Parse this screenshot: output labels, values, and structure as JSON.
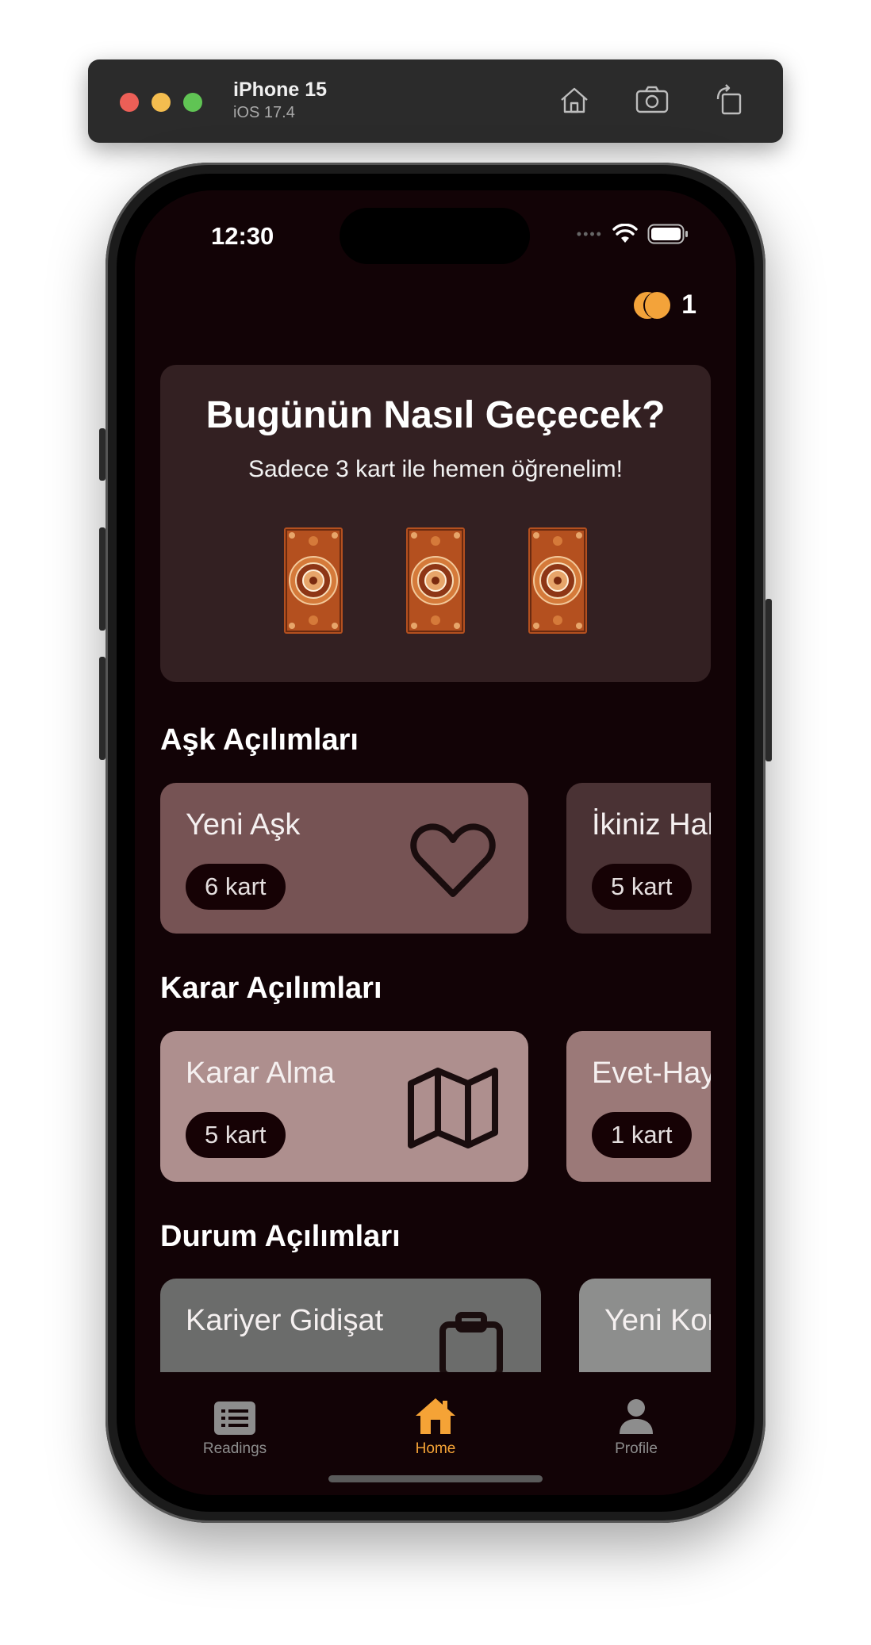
{
  "simulator": {
    "device_name": "iPhone 15",
    "os_version": "iOS 17.4",
    "toolbar_icons": [
      "home-icon",
      "screenshot-icon",
      "rotate-icon"
    ]
  },
  "status_bar": {
    "time": "12:30",
    "icons": [
      "cellular-dots-icon",
      "wifi-icon",
      "battery-icon"
    ]
  },
  "coins": {
    "count": "1",
    "icon": "coins-icon",
    "color": "#f3a33a"
  },
  "daily_reading": {
    "title": "Bugünün Nasıl Geçecek?",
    "subtitle": "Sadece 3 kart ile hemen öğrenelim!",
    "card_count": 3
  },
  "sections": [
    {
      "title": "Aşk Açılımları",
      "cards": [
        {
          "title": "Yeni Aşk",
          "badge": "6 kart",
          "icon": "heart-icon",
          "color": "#765354"
        },
        {
          "title": "İkiniz Hal",
          "badge": "5 kart",
          "icon": "",
          "color": "#4a3234"
        }
      ]
    },
    {
      "title": "Karar Açılımları",
      "cards": [
        {
          "title": "Karar Alma",
          "badge": "5 kart",
          "icon": "map-icon",
          "color": "#ae8f8e"
        },
        {
          "title": "Evet-Hay",
          "badge": "1 kart",
          "icon": "",
          "color": "#9b7978"
        }
      ]
    },
    {
      "title": "Durum Açılımları",
      "cards": [
        {
          "title": "Kariyer Gidişat",
          "badge": "",
          "icon": "clipboard-icon",
          "color": "#6b6c6b"
        },
        {
          "title": "Yeni Kon",
          "badge": "",
          "icon": "",
          "color": "#8d8e8d"
        }
      ]
    }
  ],
  "tab_bar": {
    "tabs": [
      {
        "label": "Readings",
        "icon": "list-icon",
        "active": false
      },
      {
        "label": "Home",
        "icon": "home-icon",
        "active": true
      },
      {
        "label": "Profile",
        "icon": "person-icon",
        "active": false
      }
    ],
    "active_color": "#f5a336",
    "inactive_color": "#8d8d8d"
  }
}
